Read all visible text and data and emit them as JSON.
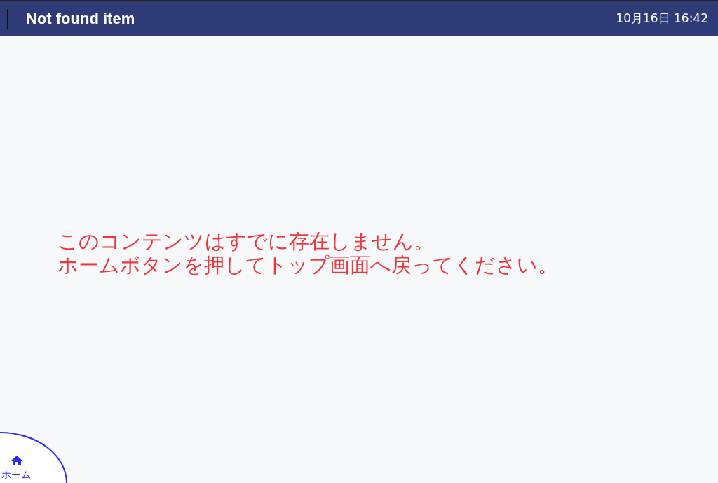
{
  "header": {
    "title": "Not found item",
    "datetime": "10月16日 16:42"
  },
  "message": [
    "このコンテンツはすでに存在しません。",
    "ホームボタンを押してトップ画面へ戻ってください。"
  ],
  "home_button": {
    "label": "ホーム"
  }
}
